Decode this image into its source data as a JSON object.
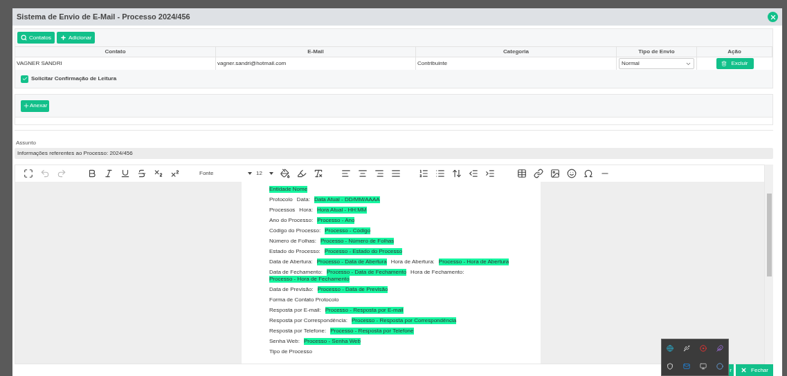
{
  "dialog": {
    "title": "Sistema de Envio de E-Mail - Processo 2024/456"
  },
  "contacts_toolbar": {
    "search_button": "Contatos",
    "add_button": "Adicionar"
  },
  "table": {
    "columns": [
      "Contato",
      "E-Mail",
      "Categoria",
      "Tipo de Envio",
      "Ação"
    ],
    "rows": [
      {
        "contato": "VAGNER SANDRI",
        "email": "vagner.sandri@hotmail.com",
        "categoria": "Contribuinte",
        "tipo_envio": "Normal",
        "action": "Excluir"
      }
    ]
  },
  "read_receipt": {
    "label": "Solicitar Confirmação de Leitura",
    "checked": true
  },
  "attach_button": "Anexar",
  "subject": {
    "label": "Assunto",
    "value": "Informações referentes ao Processo: 2024/456"
  },
  "editor": {
    "undo_disabled": true,
    "redo_disabled": true,
    "font": "Fonte",
    "size": "12",
    "lines": [
      {
        "parts": [
          {
            "text": "Entidade Nome",
            "field": true
          }
        ]
      },
      {
        "parts": [
          {
            "text": "Protocolo",
            "field": false
          },
          {
            "text": "Data:",
            "field": false
          },
          {
            "text": "Data Atual - DD/MM/AAAA",
            "field": true
          }
        ]
      },
      {
        "parts": [
          {
            "text": "Processos",
            "field": false
          },
          {
            "text": "Hora:",
            "field": false
          },
          {
            "text": "Hora Atual - HH:MM",
            "field": true
          }
        ]
      },
      {
        "parts": [
          {
            "text": "Ano do Processo:",
            "field": false
          },
          {
            "text": "Processo - Ano",
            "field": true
          }
        ]
      },
      {
        "parts": [
          {
            "text": "Código do Processo:",
            "field": false
          },
          {
            "text": "Processo - Código",
            "field": true
          }
        ]
      },
      {
        "parts": [
          {
            "text": "Número de Folhas:",
            "field": false
          },
          {
            "text": "Processo - Número de Folhas",
            "field": true
          }
        ]
      },
      {
        "parts": [
          {
            "text": "Estado do Processo:",
            "field": false
          },
          {
            "text": "Processo - Estado do Processo",
            "field": true
          }
        ]
      },
      {
        "parts": [
          {
            "text": "Data de Abertura:",
            "field": false
          },
          {
            "text": "Processo - Data de Abertura",
            "field": true
          },
          {
            "text": "Hora de Abertura:",
            "field": false
          },
          {
            "text": "Processo - Hora de Abertura",
            "field": true
          }
        ]
      },
      {
        "parts": [
          {
            "text": "Data de Fechamento:",
            "field": false
          },
          {
            "text": "Processo - Data de Fechamento",
            "field": true
          },
          {
            "text": "Hora de Fechamento:",
            "field": false
          },
          {
            "text": "Processo - Hora de Fechamento",
            "field": true
          }
        ]
      },
      {
        "parts": [
          {
            "text": "Data de Previsão:",
            "field": false
          },
          {
            "text": "Processo - Data de Previsão",
            "field": true
          }
        ]
      },
      {
        "parts": [
          {
            "text": "Forma de Contato Protocolo",
            "field": false
          }
        ]
      },
      {
        "parts": [
          {
            "text": "Resposta por E-mail:",
            "field": false
          },
          {
            "text": "Processo - Resposta por E-mail",
            "field": true
          }
        ]
      },
      {
        "parts": [
          {
            "text": "Resposta por Correspondência:",
            "field": false
          },
          {
            "text": "Processo - Resposta por Correspondência",
            "field": true
          }
        ]
      },
      {
        "parts": [
          {
            "text": "Resposta por Telefone:",
            "field": false
          },
          {
            "text": "Processo - Resposta por Telefone",
            "field": true
          }
        ]
      },
      {
        "parts": [
          {
            "text": "Senha Web:",
            "field": false
          },
          {
            "text": "Processo - Senha Web",
            "field": true
          }
        ]
      },
      {
        "parts": [
          {
            "text": "Tipo de Processo",
            "field": false
          }
        ]
      }
    ]
  },
  "footer": {
    "partial_button": "r",
    "close_button": "Fechar"
  }
}
